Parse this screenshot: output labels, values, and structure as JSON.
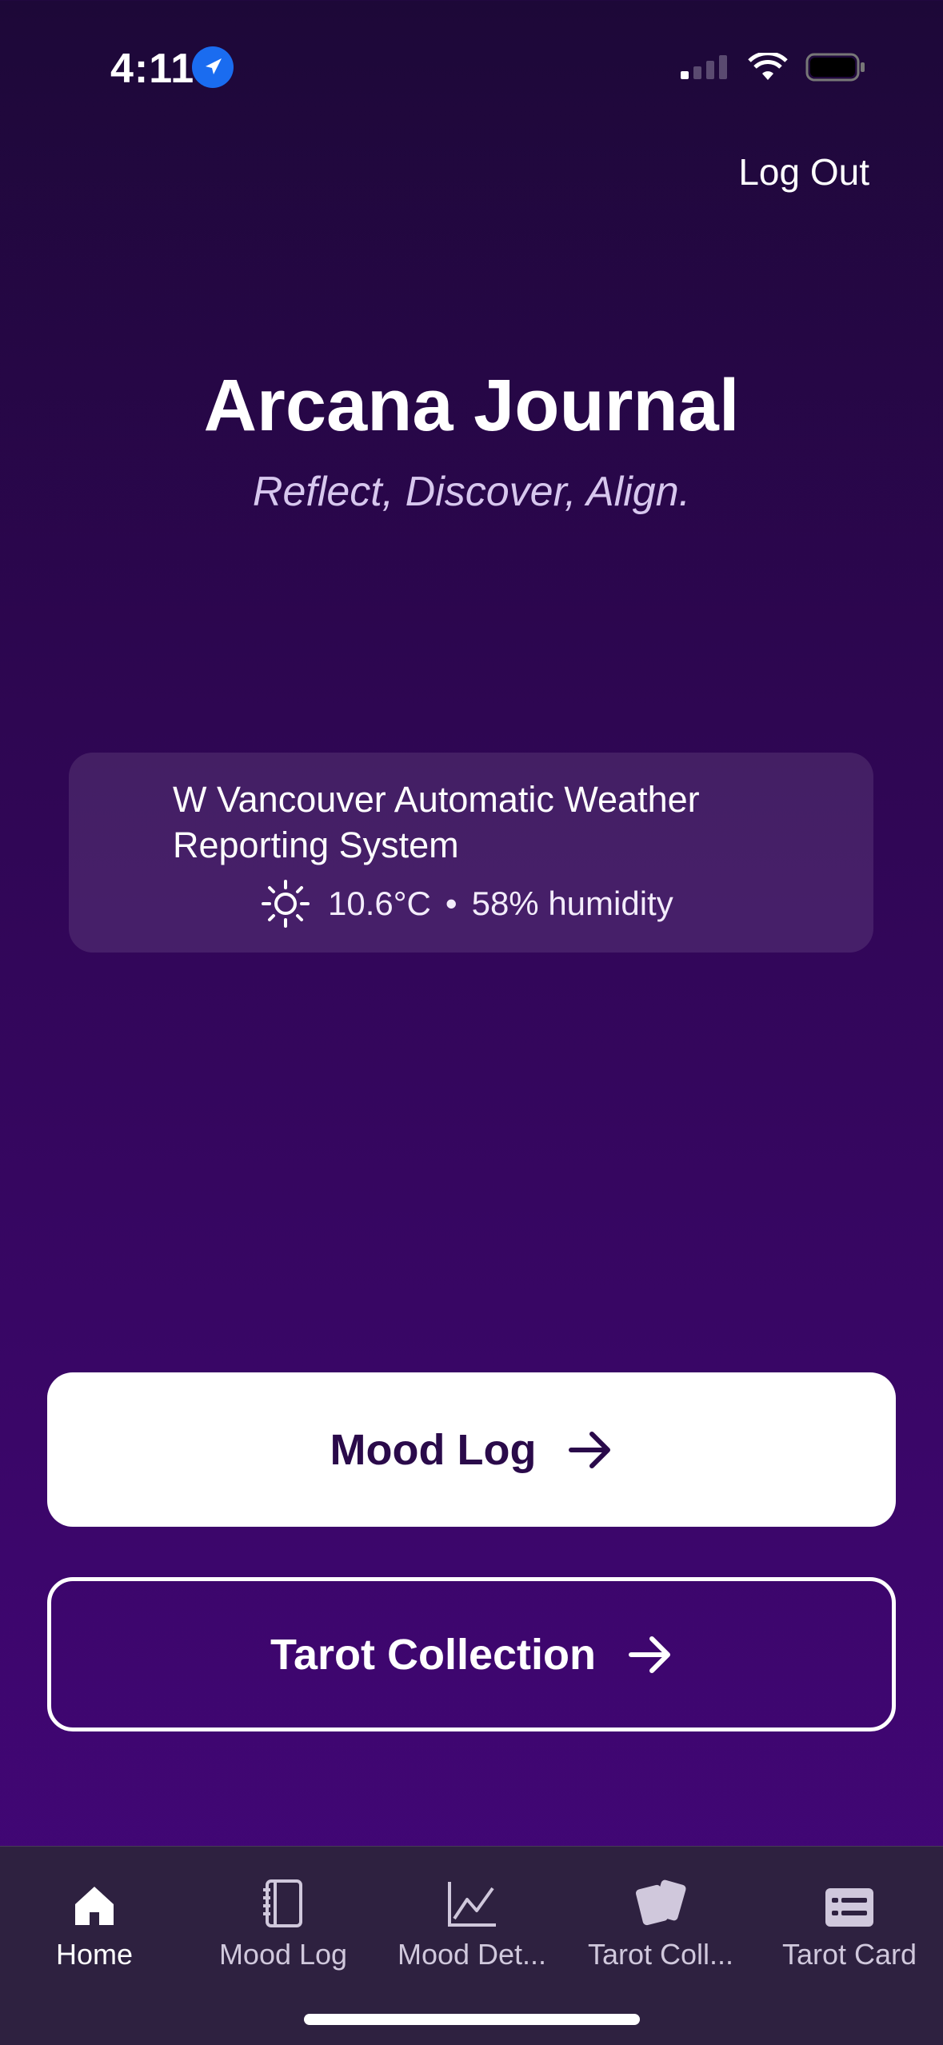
{
  "status_bar": {
    "time": "4:11"
  },
  "header": {
    "logout_label": "Log Out"
  },
  "hero": {
    "title": "Arcana Journal",
    "subtitle": "Reflect, Discover, Align."
  },
  "weather": {
    "station": "W Vancouver Automatic Weather Reporting System",
    "temperature": "10.6°C",
    "separator": "•",
    "humidity": "58% humidity",
    "icon": "sun-icon"
  },
  "actions": {
    "mood_log_label": "Mood Log",
    "tarot_collection_label": "Tarot Collection"
  },
  "tabs": [
    {
      "label": "Home",
      "icon": "home-icon",
      "active": true
    },
    {
      "label": "Mood Log",
      "icon": "notebook-icon",
      "active": false
    },
    {
      "label": "Mood Det...",
      "icon": "chart-icon",
      "active": false
    },
    {
      "label": "Tarot Coll...",
      "icon": "cards-icon",
      "active": false
    },
    {
      "label": "Tarot Card",
      "icon": "card-icon",
      "active": false
    }
  ],
  "colors": {
    "background_top": "#1d0838",
    "background_bottom": "#44077a",
    "primary_button": "#ffffff",
    "primary_button_text": "#2a0a4a",
    "tabbar": "#2e2140"
  }
}
